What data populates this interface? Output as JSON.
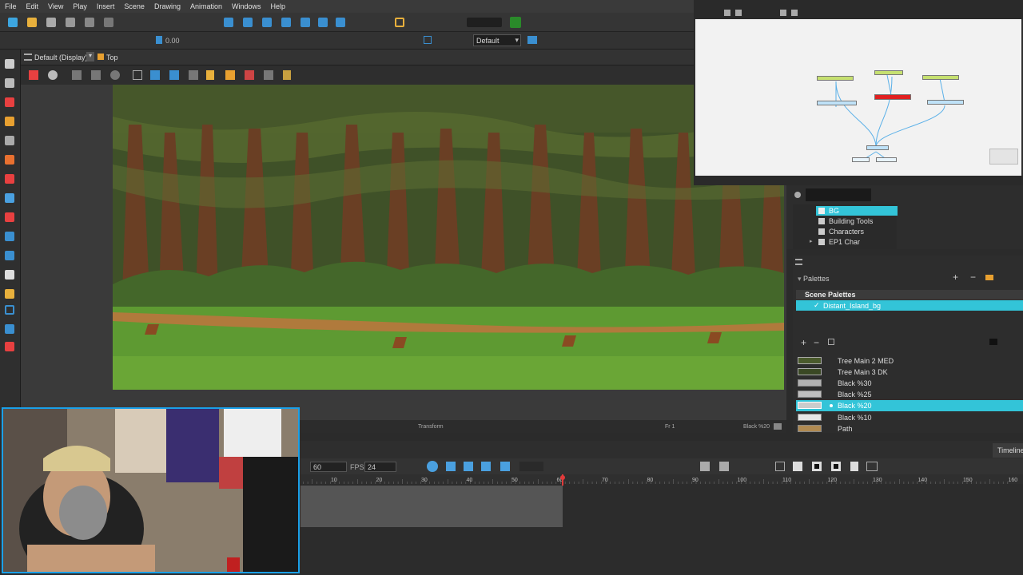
{
  "menu": [
    "File",
    "Edit",
    "View",
    "Play",
    "Insert",
    "Scene",
    "Drawing",
    "Animation",
    "Windows",
    "Help"
  ],
  "toolbar": {
    "rotation_value": "0.00",
    "preset": "Default"
  },
  "view": {
    "display_mode": "Default (Display)",
    "breadcrumb": "Top"
  },
  "status": {
    "tool": "Transform",
    "frame": "Fr 1",
    "swatch_name": "Black %20"
  },
  "library": {
    "items": [
      "BG",
      "Building Tools",
      "Characters",
      "EP1 Char"
    ]
  },
  "palettes": {
    "title": "Palettes",
    "section": "Scene Palettes",
    "palette_item": "Distant_Island_bg"
  },
  "colors": {
    "items": [
      "Tree Main 2 MED",
      "Tree Main 3 DK",
      "Black %30",
      "Black %25",
      "Black %20",
      "Black %10",
      "Path"
    ]
  },
  "timeline": {
    "tab": "Timeline",
    "frames_value": "60",
    "fps_label": "FPS",
    "fps_value": "24",
    "ruler": [
      "10",
      "20",
      "30",
      "40",
      "50",
      "60",
      "70",
      "80",
      "90",
      "100",
      "110",
      "120",
      "130",
      "140",
      "150",
      "160"
    ]
  },
  "accent": "#33c4d8",
  "playhead_color": "#e23a3a"
}
